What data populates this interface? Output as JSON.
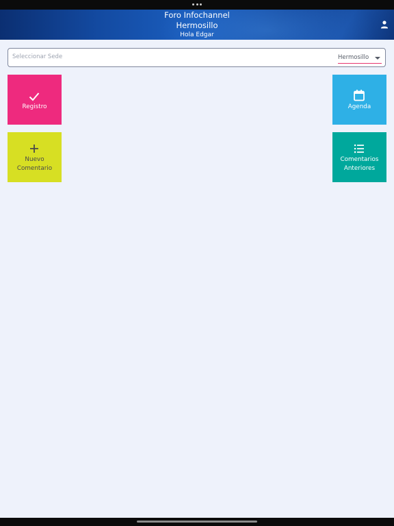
{
  "header": {
    "title": "Foro Infochannel",
    "subtitle": "Hermosillo",
    "greeting": "Hola Edgar",
    "user_icon": "person-icon"
  },
  "sede_select": {
    "placeholder": "Seleccionar Sede",
    "value": "Hermosillo",
    "underline_color": "#e6346f"
  },
  "tiles": {
    "registro": {
      "label": "Registro",
      "icon": "check-icon",
      "color": "#ee2a7e"
    },
    "agenda": {
      "label": "Agenda",
      "icon": "calendar-icon",
      "color": "#2eb0e6"
    },
    "nuevo_comentario": {
      "label_line1": "Nuevo",
      "label_line2": "Comentario",
      "icon": "plus-icon",
      "color": "#d7df23"
    },
    "comentarios_anteriores": {
      "label_line1": "Comentarios",
      "label_line2": "Anteriores",
      "icon": "list-icon",
      "color": "#00a89c"
    }
  },
  "colors": {
    "background": "#eef2fb",
    "header": "#134aa1"
  }
}
